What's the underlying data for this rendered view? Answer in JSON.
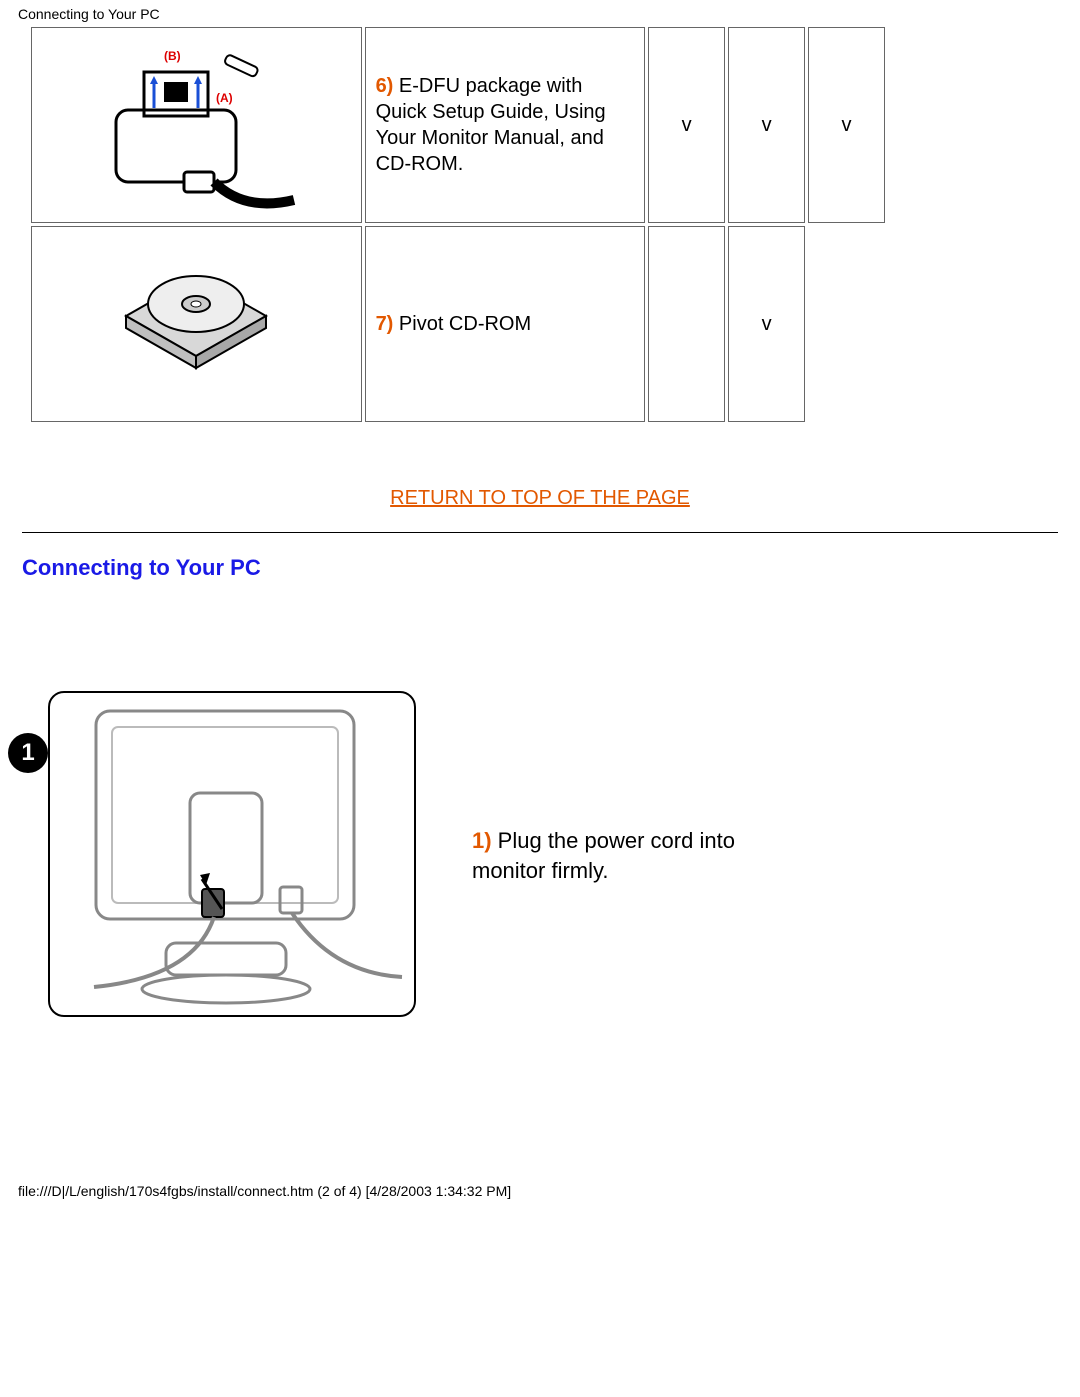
{
  "header": "Connecting to Your PC",
  "table": {
    "rows": [
      {
        "num": "6)",
        "desc": " E-DFU package with Quick Setup Guide, Using Your Monitor Manual, and CD-ROM.",
        "c1": "v",
        "c2": "v",
        "c3": "v",
        "img_labels": {
          "a": "(A)",
          "b": "(B)"
        }
      },
      {
        "num": "7)",
        "desc": " Pivot CD-ROM",
        "c1": "",
        "c2": "v",
        "c3": ""
      }
    ]
  },
  "return_link": "RETURN TO TOP OF THE PAGE",
  "section_title": "Connecting to Your PC",
  "step": {
    "badge": "1",
    "num": "1)",
    "text": " Plug the power cord into monitor firmly."
  },
  "footer": "file:///D|/L/english/170s4fgbs/install/connect.htm (2 of 4) [4/28/2003 1:34:32 PM]"
}
